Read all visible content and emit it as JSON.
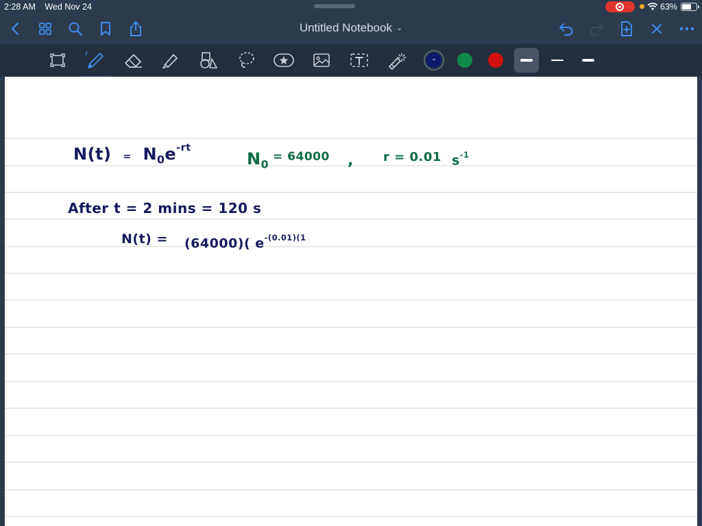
{
  "status_bar": {
    "time": "2:28 AM",
    "date": "Wed Nov 24",
    "battery_pct": "63%",
    "battery_level": 0.63
  },
  "nav": {
    "title": "Untitled Notebook",
    "icons": [
      "back-icon",
      "grid-icon",
      "search-icon",
      "bookmark-icon",
      "share-icon",
      "undo-icon",
      "redo-icon",
      "add-page-icon",
      "close-icon",
      "more-icon"
    ]
  },
  "toolbar": {
    "tools": [
      "lasso-select-tool",
      "pen-tool",
      "eraser-tool",
      "highlighter-tool",
      "shapes-tool",
      "lasso-tool",
      "sticker-tool",
      "image-tool",
      "text-tool",
      "laser-pointer-tool"
    ],
    "selected_tool": "pen-tool",
    "colors": [
      "#0b1a6e",
      "#0f8a4a",
      "#d01010"
    ],
    "selected_color": "#0b1a6e",
    "stroke_widths": [
      "thick",
      "medium",
      "thin"
    ],
    "selected_stroke": "thick"
  },
  "notes": {
    "formula": {
      "lhs": "N(t)",
      "eq": "=",
      "n0": "N",
      "n0_sub": "0",
      "e": "e",
      "exp": "-rt"
    },
    "given": {
      "n0": "N",
      "n0_sub": "0",
      "n0_value": "= 64000",
      "comma": ",",
      "r": "r = 0.01",
      "unit": "s",
      "unit_exp": "-1"
    },
    "after_line": "After  t = 2 mins  =  120 s",
    "calc": {
      "lhs": "N(t) =",
      "body": "(64000)( e",
      "exp": "-(0.01)(1"
    }
  },
  "colors": {
    "ink_navy": "#141a5e",
    "ink_green": "#0f6b44",
    "ruled_line": "#d3d3d3",
    "accent_blue": "#3d8ef0"
  }
}
